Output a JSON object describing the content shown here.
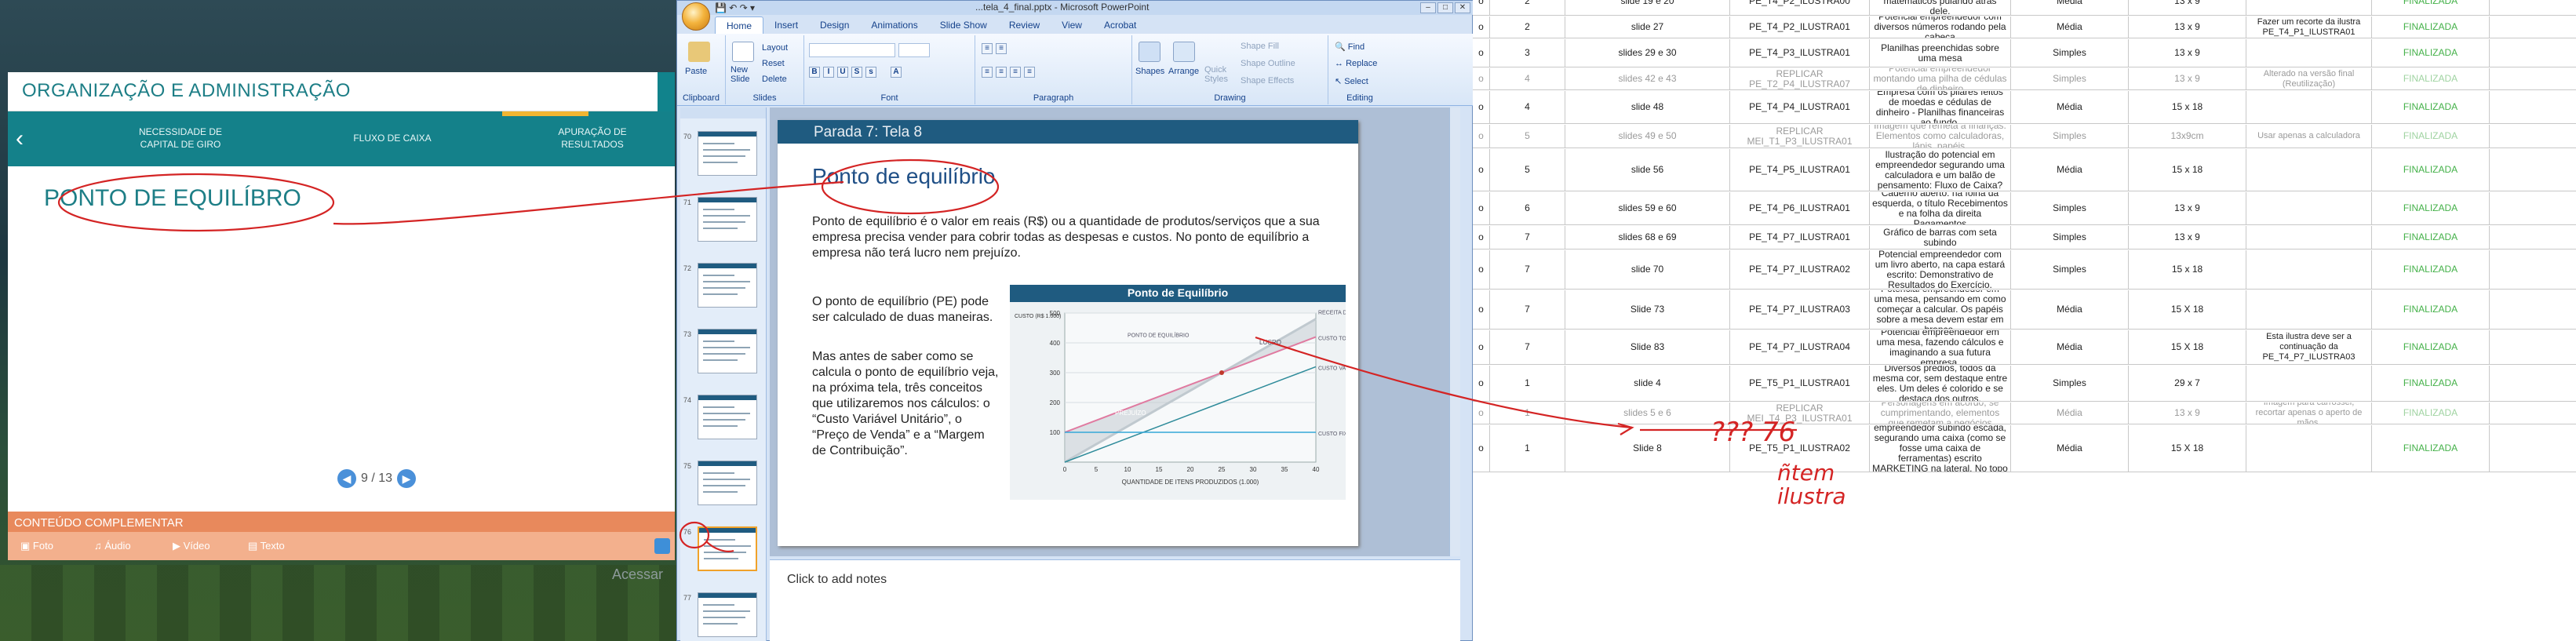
{
  "course": {
    "title": "ORGANIZAÇÃO E ADMINISTRAÇÃO",
    "nav": [
      {
        "label": "NECESSIDADE DE\nCAPITAL DE GIRO"
      },
      {
        "label": "FLUXO DE CAIXA"
      },
      {
        "label": "APURAÇÃO DE\nRESULTADOS"
      }
    ],
    "topic": "PONTO DE EQUILÍBRO",
    "pager": "9 / 13",
    "complement": "CONTEÚDO COMPLEMENTAR",
    "comp_tabs": [
      "Foto",
      "Áudio",
      "Vídeo",
      "Texto"
    ],
    "access": "Acessar"
  },
  "ppt": {
    "window_title": "...tela_4_final.pptx - Microsoft PowerPoint",
    "tabs": [
      "Home",
      "Insert",
      "Design",
      "Animations",
      "Slide Show",
      "Review",
      "View",
      "Acrobat"
    ],
    "groups": [
      "Clipboard",
      "Slides",
      "Font",
      "Paragraph",
      "Drawing",
      "Editing"
    ],
    "buttons": {
      "paste": "Paste",
      "new_slide": "New\nSlide",
      "layout": "Layout",
      "reset": "Reset",
      "delete": "Delete",
      "shapes": "Shapes",
      "arrange": "Arrange",
      "quick_styles": "Quick\nStyles",
      "shape_fill": "Shape Fill",
      "shape_outline": "Shape Outline",
      "shape_effects": "Shape Effects",
      "find": "Find",
      "replace": "Replace",
      "select": "Select"
    },
    "thumb_numbers": [
      "70",
      "71",
      "72",
      "73",
      "74",
      "75",
      "76",
      "77"
    ],
    "slide": {
      "header": "Parada 7: Tela 8",
      "title": "Ponto de equilíbrio",
      "p1": "Ponto de equilíbrio é o valor em reais (R$) ou a quantidade de produtos/serviços que a sua empresa precisa vender para cobrir todas as despesas e custos. No ponto de equilíbrio a empresa não terá lucro nem prejuízo.",
      "p2": "O ponto de equilíbrio (PE) pode ser calculado de duas maneiras.",
      "p3": "Mas antes de saber como se calcula o ponto de equilíbrio veja, na próxima tela, três conceitos que utilizaremos nos cálculos: o “Custo Variável Unitário”, o “Preço de Venda” e a “Margem de Contribuição”."
    },
    "notes_placeholder": "Click to add notes"
  },
  "chart_data": {
    "type": "line",
    "title": "Ponto de Equilíbrio",
    "xlabel": "QUANTIDADE DE ITENS PRODUZIDOS (1.000)",
    "ylabel": "CUSTO (R$ 1.000)",
    "x": [
      0,
      5,
      10,
      15,
      20,
      25,
      30,
      35,
      40
    ],
    "xlim": [
      0,
      40
    ],
    "ylim": [
      0,
      500
    ],
    "yticks": [
      100,
      200,
      300,
      400,
      500
    ],
    "series": [
      {
        "name": "RECEITA DE VENDAS",
        "values": [
          0,
          60,
          120,
          180,
          240,
          300,
          360,
          420,
          480
        ]
      },
      {
        "name": "CUSTO TOTAL",
        "values": [
          100,
          140,
          180,
          220,
          260,
          300,
          340,
          380,
          420
        ]
      },
      {
        "name": "CUSTO VARIÁVEL",
        "values": [
          0,
          40,
          80,
          120,
          160,
          200,
          240,
          280,
          320
        ]
      },
      {
        "name": "CUSTO FIXO",
        "values": [
          100,
          100,
          100,
          100,
          100,
          100,
          100,
          100,
          100
        ]
      }
    ],
    "annotations": [
      "PONTO DE EQUILÍBRIO",
      "LUCRO",
      "PREJUÍZO"
    ],
    "colors": {
      "receita": "#c0c9cf",
      "custo_total": "#e07aa0",
      "custo_variavel": "#2e8b9a",
      "custo_fixo": "#35a7d8",
      "header": "#1f5b80"
    }
  },
  "sheet": {
    "rows": [
      {
        "a": "o",
        "b": "2",
        "c": "slide 19 e 20",
        "d": "PE_T4_P2_ILUSTRA00",
        "e": "números e diversos caracteres matemáticos pulando atrás dele.",
        "f": "Média",
        "g": "13 x 9",
        "h": "",
        "i": "FINALIZADA",
        "faded": false
      },
      {
        "a": "o",
        "b": "2",
        "c": "slide 27",
        "d": "PE_T4_P2_ILUSTRA01",
        "e": "Potencial empreendedor com diversos números rodando pela cabeça",
        "f": "Média",
        "g": "13 x 9",
        "h": "Fazer um recorte da ilustra PE_T4_P1_ILUSTRA01",
        "i": "FINALIZADA",
        "faded": false
      },
      {
        "a": "o",
        "b": "3",
        "c": "slides 29 e 30",
        "d": "PE_T4_P3_ILUSTRA01",
        "e": "Planilhas preenchidas sobre uma mesa",
        "f": "Simples",
        "g": "13 x 9",
        "h": "",
        "i": "FINALIZADA",
        "faded": false
      },
      {
        "a": "o",
        "b": "4",
        "c": "slides 42 e 43",
        "d": "REPLICAR PE_T2_P4_ILUSTRA07",
        "e": "Potencial empreendedor montando uma pilha de cédulas de dinheiro",
        "f": "Simples",
        "g": "13 x 9",
        "h": "Alterado na versão final (Reutilização)",
        "i": "FINALIZADA",
        "faded": true
      },
      {
        "a": "o",
        "b": "4",
        "c": "slide 48",
        "d": "PE_T4_P4_ILUSTRA01",
        "e": "Empresa com os pilares feitos de moedas e cédulas de dinheiro - Planilhas financeiras ao fundo.",
        "f": "Média",
        "g": "15 x 18",
        "h": "",
        "i": "FINALIZADA",
        "faded": false
      },
      {
        "a": "o",
        "b": "5",
        "c": "slides 49 e 50",
        "d": "REPLICAR MEI_T1_P3_ILUSTRA01",
        "e": "Imagem que remeta a finanças. Elementos como calculadoras, lápis, papéis.",
        "f": "Simples",
        "g": "13x9cm",
        "h": "Usar apenas a calculadora",
        "i": "FINALIZADA",
        "faded": true
      },
      {
        "a": "o",
        "b": "5",
        "c": "slide 56",
        "d": "PE_T4_P5_ILUSTRA01",
        "e": "Ilustração do potencial em empreendedor segurando uma calculadora e um balão de pensamento: Fluxo de Caixa?",
        "f": "Média",
        "g": "15 x 18",
        "h": "",
        "i": "FINALIZADA",
        "faded": false
      },
      {
        "a": "o",
        "b": "6",
        "c": "slides 59 e 60",
        "d": "PE_T4_P6_ILUSTRA01",
        "e": "Caderno aberto: na folha da esquerda, o título Recebimentos e na folha da direita Pagamentos",
        "f": "Simples",
        "g": "13 x 9",
        "h": "",
        "i": "FINALIZADA",
        "faded": false
      },
      {
        "a": "o",
        "b": "7",
        "c": "slides 68 e 69",
        "d": "PE_T4_P7_ILUSTRA01",
        "e": "Gráfico de barras com seta subindo",
        "f": "Simples",
        "g": "13 x 9",
        "h": "",
        "i": "FINALIZADA",
        "faded": false
      },
      {
        "a": "o",
        "b": "7",
        "c": "slide 70",
        "d": "PE_T4_P7_ILUSTRA02",
        "e": "Potencial empreendedor com um livro aberto, na capa estará escrito: Demonstrativo de Resultados do Exercício.",
        "f": "Simples",
        "g": "15 x 18",
        "h": "",
        "i": "FINALIZADA",
        "faded": false
      },
      {
        "a": "o",
        "b": "7",
        "c": "Slide 73",
        "d": "PE_T4_P7_ILUSTRA03",
        "e": "Potencial empreendedor em uma mesa, pensando em como começar a calcular. Os papéis sobre a mesa devem estar em branco.",
        "f": "Média",
        "g": "15 X 18",
        "h": "",
        "i": "FINALIZADA",
        "faded": false
      },
      {
        "a": "o",
        "b": "7",
        "c": "Slide 83",
        "d": "PE_T4_P7_ILUSTRA04",
        "e": "Potencial empreendedor em uma mesa, fazendo cálculos e imaginando a sua futura empresa.",
        "f": "Média",
        "g": "15 X 18",
        "h": "Esta ilustra deve ser a continuação da PE_T4_P7_ILUSTRA03",
        "i": "FINALIZADA",
        "faded": false
      },
      {
        "a": "o",
        "b": "1",
        "c": "slide 4",
        "d": "PE_T5_P1_ILUSTRA01",
        "e": "Diversos prédios, todos da mesma cor, sem destaque entre eles. Um deles é colorido e se destaca dos outros.",
        "f": "Simples",
        "g": "29 x 7",
        "h": "",
        "i": "FINALIZADA",
        "faded": false
      },
      {
        "a": "o",
        "b": "1",
        "c": "slides 5 e 6",
        "d": "REPLICAR MEI_T4_P3_ILUSTRA01",
        "e": "Personagens em acordo, se cumprimentando, elementos que remetam a negócios",
        "f": "Média",
        "g": "13 x 9",
        "h": "Imagem para carrossel, recortar apenas o aperto de mãos.",
        "i": "FINALIZADA",
        "faded": true
      },
      {
        "a": "o",
        "b": "1",
        "c": "Slide 8",
        "d": "PE_T5_P1_ILUSTRA02",
        "e": "Ilustração de um potencial empreendedor subindo escada, segurando uma caixa (como se fosse uma caixa de ferramentas) escrito MARKETING na lateral. No topo da escada, a palavra sucesso.",
        "f": "Média",
        "g": "15 X 18",
        "h": "",
        "i": "FINALIZADA",
        "faded": false
      }
    ]
  },
  "handwriting": {
    "note1": "??? 76",
    "note2": "ñtem\nilustra"
  }
}
